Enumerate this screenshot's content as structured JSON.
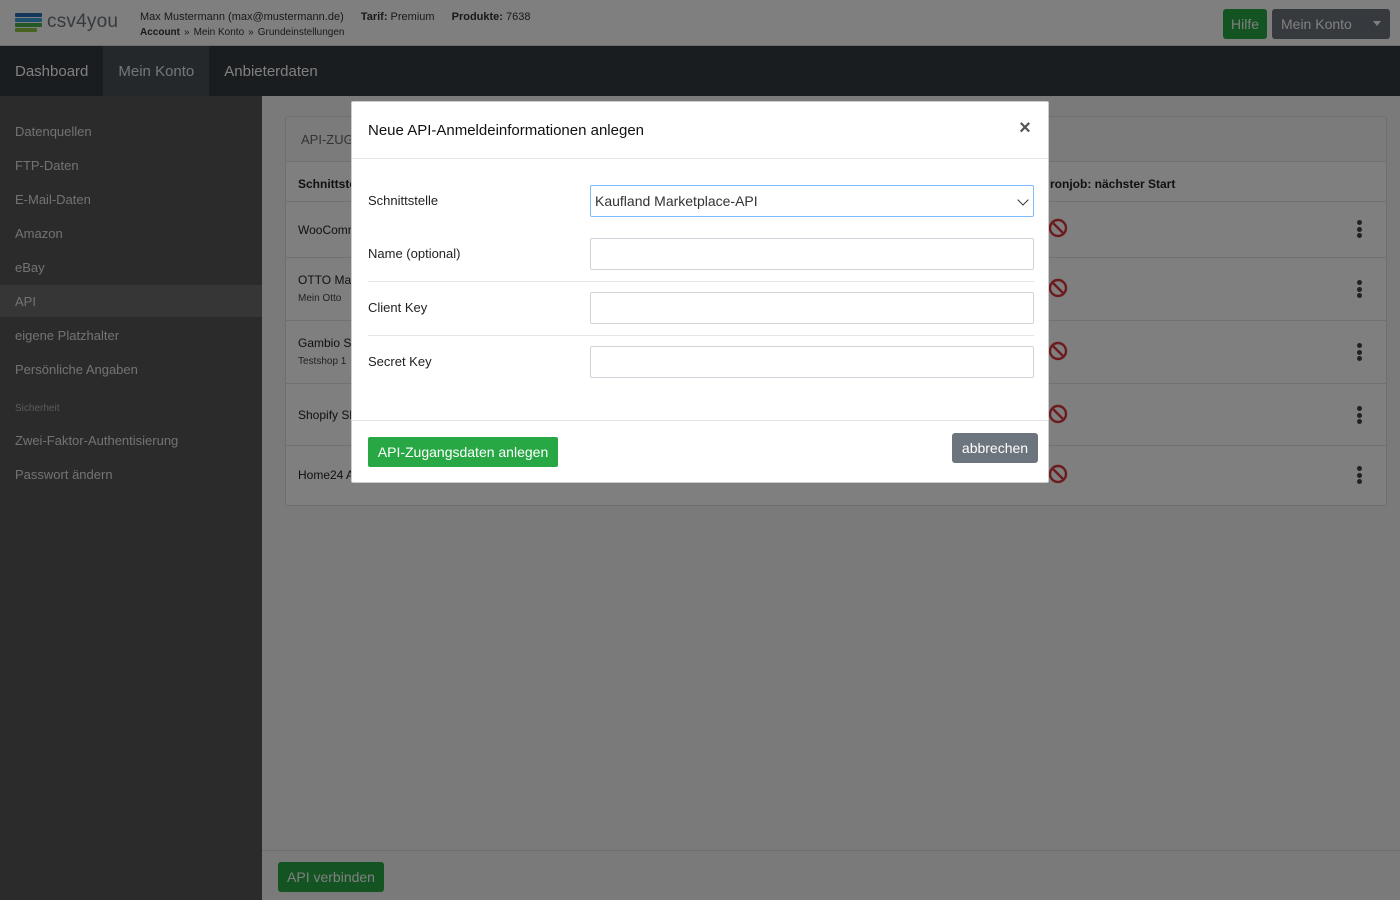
{
  "app": {
    "logo_text": "csv4you",
    "user": "Max Mustermann (max@mustermann.de)",
    "tarif_label": "Tarif:",
    "tarif_value": "Premium",
    "produkte_label": "Produkte:",
    "produkte_value": "7638",
    "breadcrumb": [
      "Account",
      "Mein Konto",
      "Grundeinstellungen"
    ],
    "breadcrumb_sep": "»",
    "hilfe_label": "Hilfe",
    "konto_label": "Mein Konto"
  },
  "nav": {
    "items": [
      {
        "label": "Dashboard"
      },
      {
        "label": "Mein Konto"
      },
      {
        "label": "Anbieterdaten"
      }
    ]
  },
  "sidebar": {
    "items": [
      {
        "label": "Datenquellen"
      },
      {
        "label": "FTP-Daten"
      },
      {
        "label": "E-Mail-Daten"
      },
      {
        "label": "Amazon"
      },
      {
        "label": "eBay"
      },
      {
        "label": "API"
      },
      {
        "label": "eigene Platzhalter"
      },
      {
        "label": "Persönliche Angaben"
      }
    ],
    "heading": "Sicherheit",
    "security_items": [
      {
        "label": "Zwei-Faktor-Authentisierung"
      },
      {
        "label": "Passwort ändern"
      }
    ]
  },
  "card": {
    "header": "API-ZUG",
    "col_schnittstelle": "Schnittste",
    "col_cronjob": "ronjob: nächster Start",
    "rows": [
      {
        "name": "WooComm",
        "sub": ""
      },
      {
        "name": "OTTO Mar",
        "sub": "Mein Otto"
      },
      {
        "name": "Gambio S",
        "sub": "Testshop 1"
      },
      {
        "name": "Shopify Sh",
        "sub": ""
      },
      {
        "name": "Home24 A",
        "sub": ""
      }
    ]
  },
  "footer": {
    "verbinden_label": "API verbinden"
  },
  "modal": {
    "title": "Neue API-Anmeldeinformationen anlegen",
    "close": "×",
    "fields": {
      "schnittstelle": {
        "label": "Schnittstelle",
        "value": "Kaufland Marketplace-API"
      },
      "name": {
        "label": "Name (optional)",
        "value": ""
      },
      "client_key": {
        "label": "Client Key",
        "value": ""
      },
      "secret_key": {
        "label": "Secret Key",
        "value": ""
      }
    },
    "submit_label": "API-Zugangsdaten anlegen",
    "cancel_label": "abbrechen"
  },
  "colors": {
    "success": "#28a745",
    "secondary": "#6c757d",
    "nav_dark": "#343a40",
    "danger_icon": "#d9363e"
  }
}
